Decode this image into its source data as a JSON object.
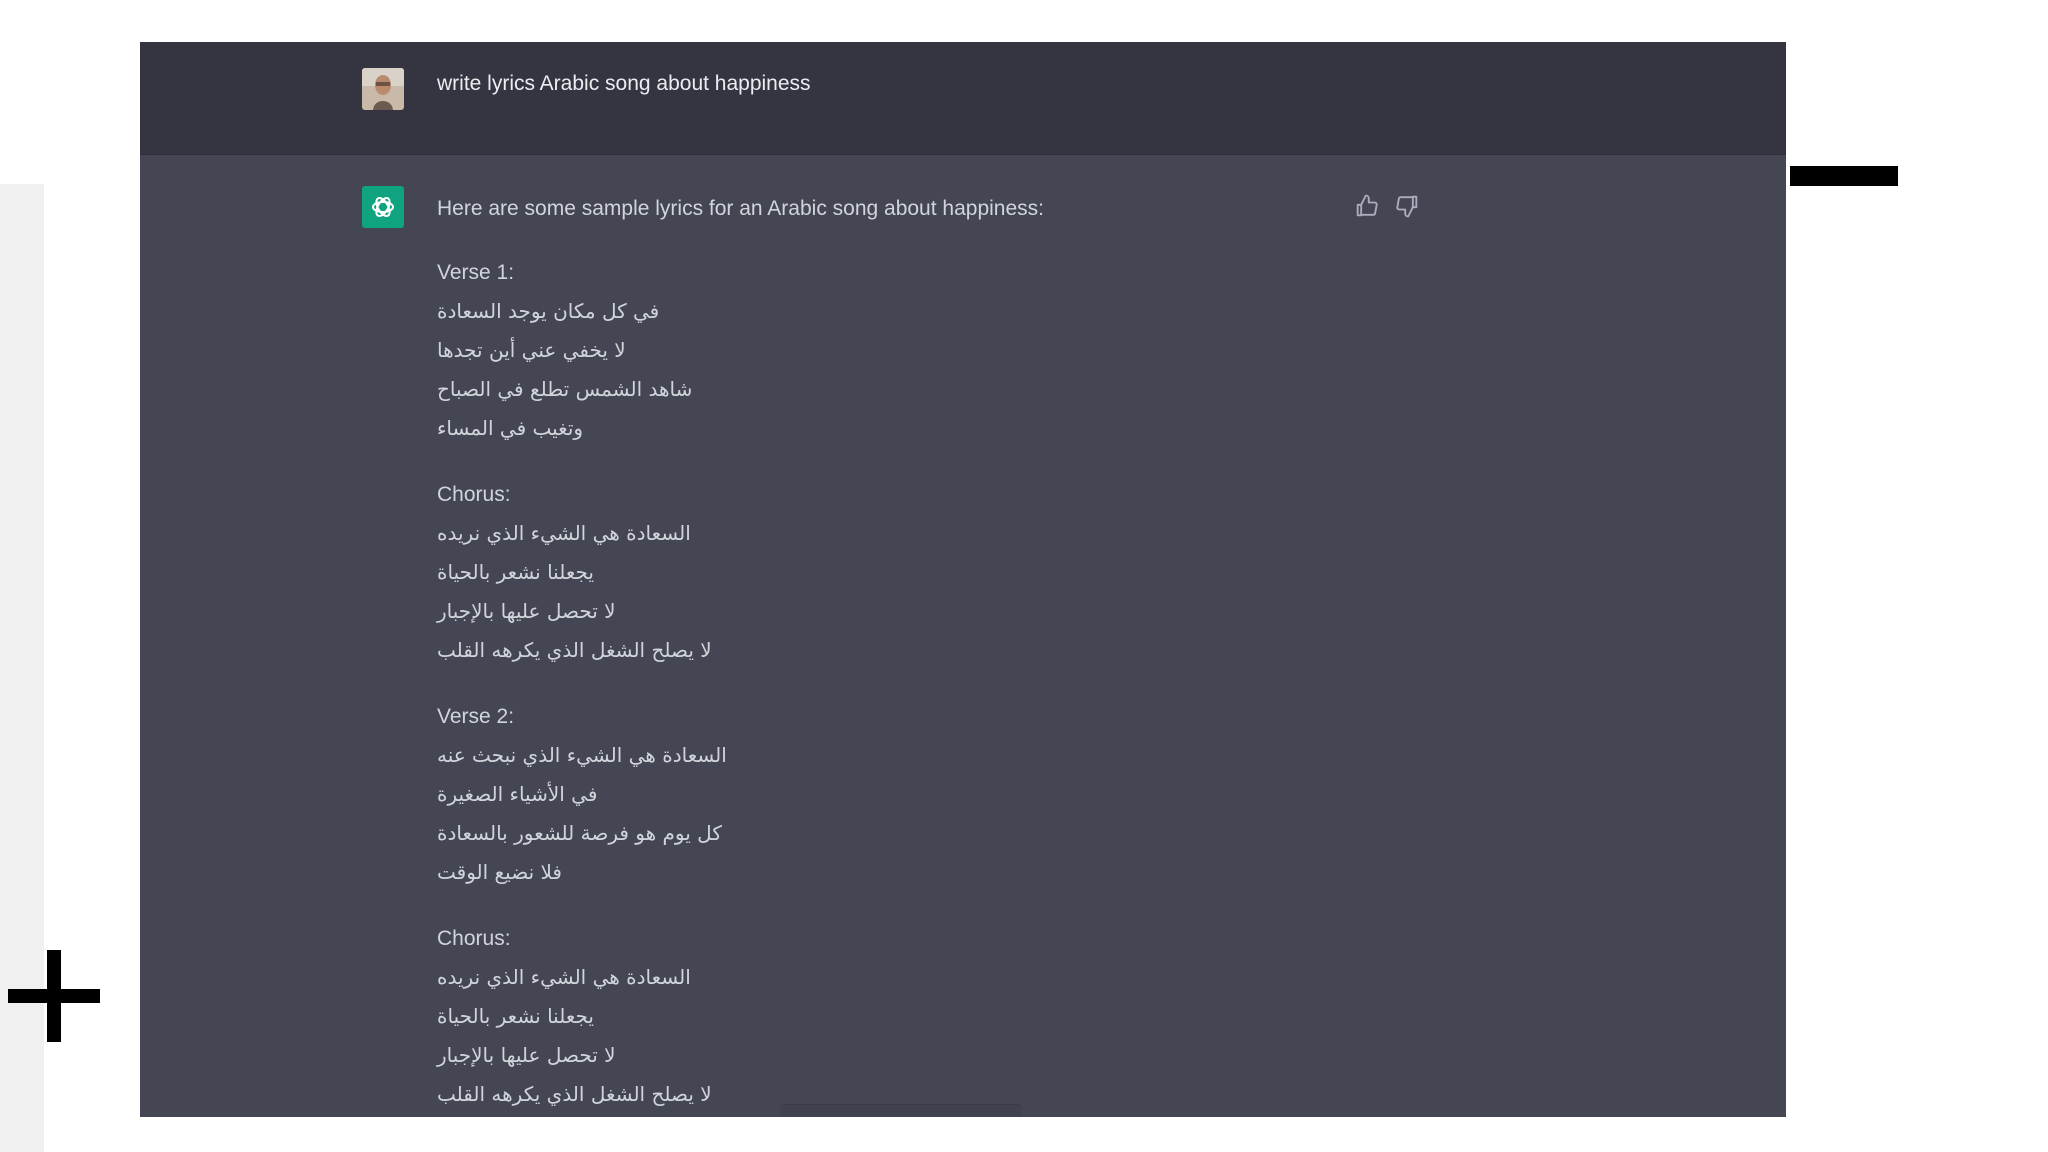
{
  "user_message": {
    "text": "write lyrics Arabic song about happiness"
  },
  "assistant_message": {
    "intro": "Here are some sample lyrics for an Arabic song about happiness:",
    "stanzas": [
      {
        "heading": "Verse 1:",
        "lines": [
          "في كل مكان يوجد السعادة",
          "لا يخفي عني أين تجدها",
          "شاهد الشمس تطلع في الصباح",
          "وتغيب في المساء"
        ]
      },
      {
        "heading": "Chorus:",
        "lines": [
          "السعادة هي الشيء الذي نريده",
          "يجعلنا نشعر بالحياة",
          "لا تحصل عليها بالإجبار",
          "لا يصلح الشغل الذي يكرهه القلب"
        ]
      },
      {
        "heading": "Verse 2:",
        "lines": [
          "السعادة هي الشيء الذي نبحث عنه",
          "في الأشياء الصغيرة",
          "كل يوم هو فرصة للشعور بالسعادة",
          "فلا نضيع الوقت"
        ]
      },
      {
        "heading": "Chorus:",
        "lines": [
          "السعادة هي الشيء الذي نريده",
          "يجعلنا نشعر بالحياة",
          "لا تحصل عليها بالإجبار",
          "لا يصلح الشغل الذي يكرهه القلب"
        ]
      }
    ]
  },
  "icons": {
    "bot_avatar": "openai-logo-icon",
    "user_avatar": "user-avatar",
    "thumbs_up": "thumbs-up-icon",
    "thumbs_down": "thumbs-down-icon",
    "plus": "plus-icon"
  },
  "colors": {
    "user_row_bg": "#343541",
    "assistant_row_bg": "#444654",
    "bot_logo_bg": "#10a37f",
    "text": "#d1d5db"
  }
}
